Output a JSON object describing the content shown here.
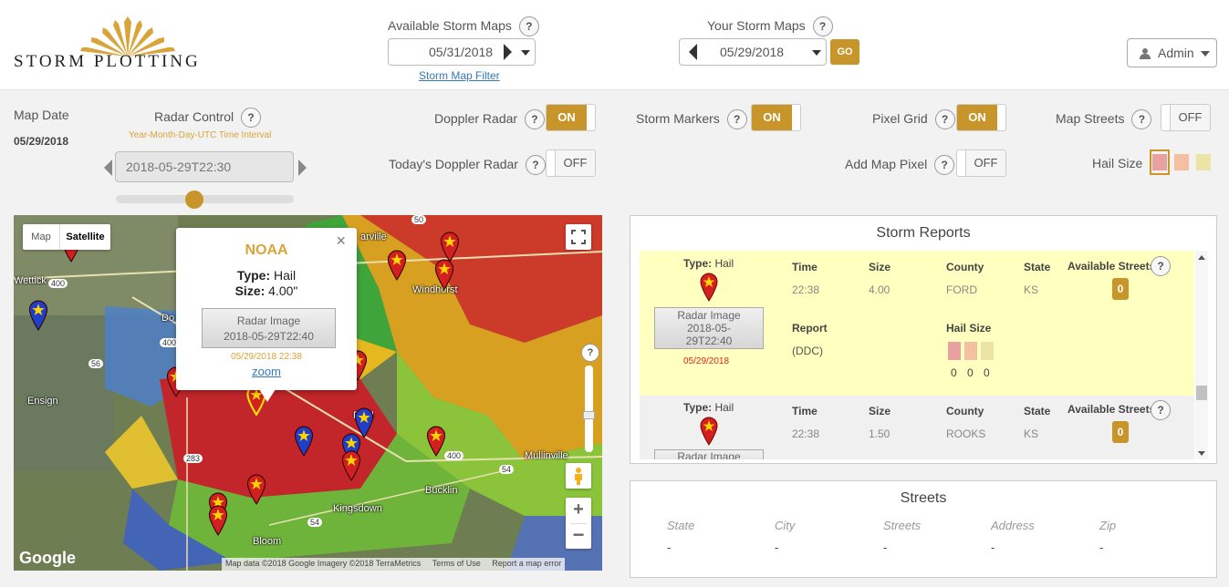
{
  "header": {
    "logo_text": "STORM PLOTTING",
    "available_label": "Available Storm Maps",
    "available_date": "05/31/2018",
    "filter_link": "Storm Map Filter",
    "your_label": "Your Storm Maps",
    "your_date": "05/29/2018",
    "go_label": "GO",
    "admin_label": "Admin",
    "help": "?"
  },
  "controls": {
    "map_date_label": "Map Date",
    "map_date_value": "05/29/2018",
    "radar_control_label": "Radar Control",
    "interval_note": "Year-Month-Day-UTC Time Interval",
    "radar_time": "2018-05-29T22:30",
    "slider_level": 0.44,
    "doppler_label": "Doppler Radar",
    "doppler_state": "ON",
    "todays_doppler_label": "Today's Doppler Radar",
    "todays_doppler_state": "OFF",
    "storm_markers_label": "Storm Markers",
    "storm_markers_state": "ON",
    "pixel_grid_label": "Pixel Grid",
    "pixel_grid_state": "ON",
    "add_pixel_label": "Add Map Pixel",
    "add_pixel_state": "OFF",
    "map_streets_label": "Map Streets",
    "map_streets_state": "OFF",
    "hail_size_label": "Hail Size",
    "hail_colors": [
      "#e8a0a0",
      "#f4c0a0",
      "#ece4a4"
    ]
  },
  "map": {
    "type_map": "Map",
    "type_satellite": "Satellite",
    "google": "Google",
    "attribution": "Map data ©2018 Google Imagery ©2018 TerraMetrics",
    "terms": "Terms of Use",
    "report_error": "Report a map error",
    "towns": {
      "wettick": "Wettick",
      "ensign": "Ensign",
      "dodge": "Do",
      "windhorst": "Windhorst",
      "ford": "Ford",
      "mullinville": "Mullinville",
      "kingsdown": "Kingsdown",
      "bucklin": "Bucklin",
      "bloom": "Bloom",
      "spearville": "arville"
    },
    "roads": {
      "r400a": "400",
      "r400b": "400",
      "r56": "56",
      "r283": "283",
      "r54a": "54",
      "r54b": "54",
      "r50": "50",
      "r400c": "400"
    },
    "popup": {
      "title": "NOAA",
      "type_label": "Type:",
      "type_value": "Hail",
      "size_label": "Size:",
      "size_value": "4.00\"",
      "radar_btn_line1": "Radar Image",
      "radar_btn_line2": "2018-05-29T22:40",
      "timestamp": "05/29/2018 22:38",
      "zoom": "zoom",
      "close": "×"
    }
  },
  "storm_reports": {
    "title": "Storm Reports",
    "type_label": "Type:",
    "time_label": "Time",
    "size_label": "Size",
    "county_label": "County",
    "state_label": "State",
    "streets_label": "Available Streets",
    "report_label": "Report",
    "hail_size_label": "Hail Size",
    "rows": [
      {
        "type": "Hail",
        "time": "22:38",
        "size": "4.00",
        "county": "FORD",
        "state": "KS",
        "streets": "0",
        "report": "(DDC)",
        "radar_line1": "Radar Image",
        "radar_line2": "2018-05-",
        "radar_line3": "29T22:40",
        "date": "05/29/2018",
        "hail_counts": [
          "0",
          "0",
          "0"
        ]
      },
      {
        "type": "Hail",
        "time": "22:38",
        "size": "1.50",
        "county": "ROOKS",
        "state": "KS",
        "streets": "0",
        "radar_line1": "Radar Image"
      }
    ]
  },
  "streets": {
    "title": "Streets",
    "headers": [
      "State",
      "City",
      "Streets",
      "Address",
      "Zip"
    ],
    "values": [
      "-",
      "-",
      "-",
      "-",
      "-"
    ]
  }
}
